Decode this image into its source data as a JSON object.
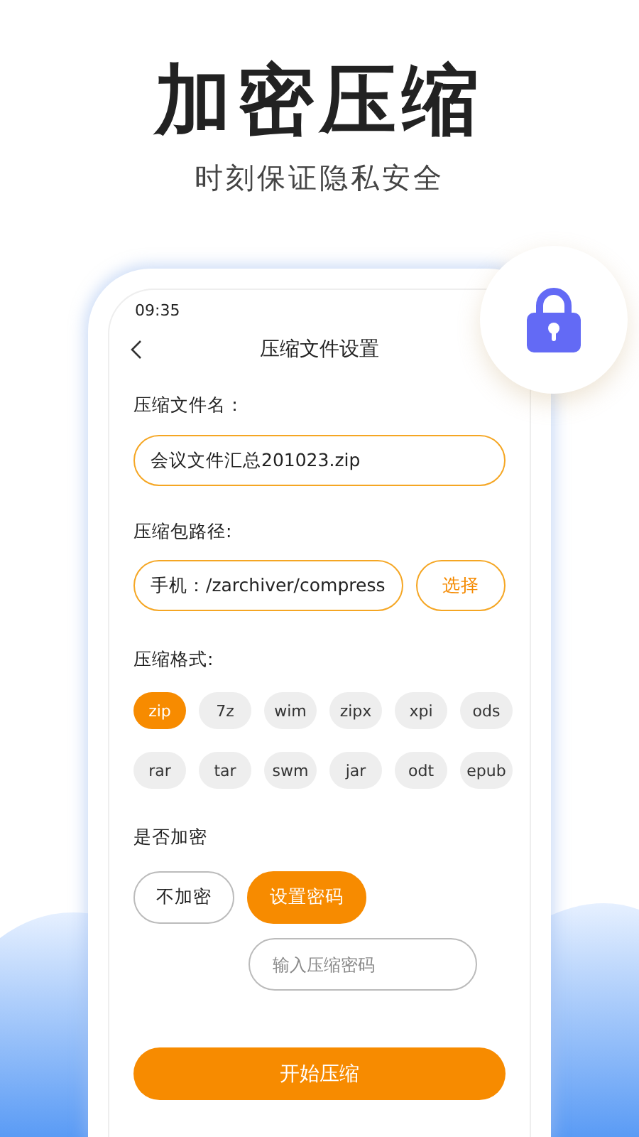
{
  "headline": "加密压缩",
  "subtitle": "时刻保证隐私安全",
  "screen": {
    "status_time": "09:35",
    "title": "压缩文件设置",
    "filename": {
      "label": "压缩文件名：",
      "value": "会议文件汇总201023.zip"
    },
    "path": {
      "label": "压缩包路径:",
      "value": "手机：/zarchiver/compress",
      "button": "选择"
    },
    "format": {
      "label": "压缩格式:",
      "options": [
        {
          "label": "zip",
          "selected": true
        },
        {
          "label": "7z",
          "selected": false
        },
        {
          "label": "wim",
          "selected": false
        },
        {
          "label": "zipx",
          "selected": false
        },
        {
          "label": "xpi",
          "selected": false
        },
        {
          "label": "ods",
          "selected": false
        },
        {
          "label": "rar",
          "selected": false
        },
        {
          "label": "tar",
          "selected": false
        },
        {
          "label": "swm",
          "selected": false
        },
        {
          "label": "jar",
          "selected": false
        },
        {
          "label": "odt",
          "selected": false
        },
        {
          "label": "epub",
          "selected": false
        }
      ]
    },
    "encryption": {
      "label": "是否加密",
      "options": [
        {
          "label": "不加密",
          "selected": false
        },
        {
          "label": "设置密码",
          "selected": true
        }
      ],
      "password_placeholder": "输入压缩密码"
    },
    "start_button": "开始压缩"
  }
}
